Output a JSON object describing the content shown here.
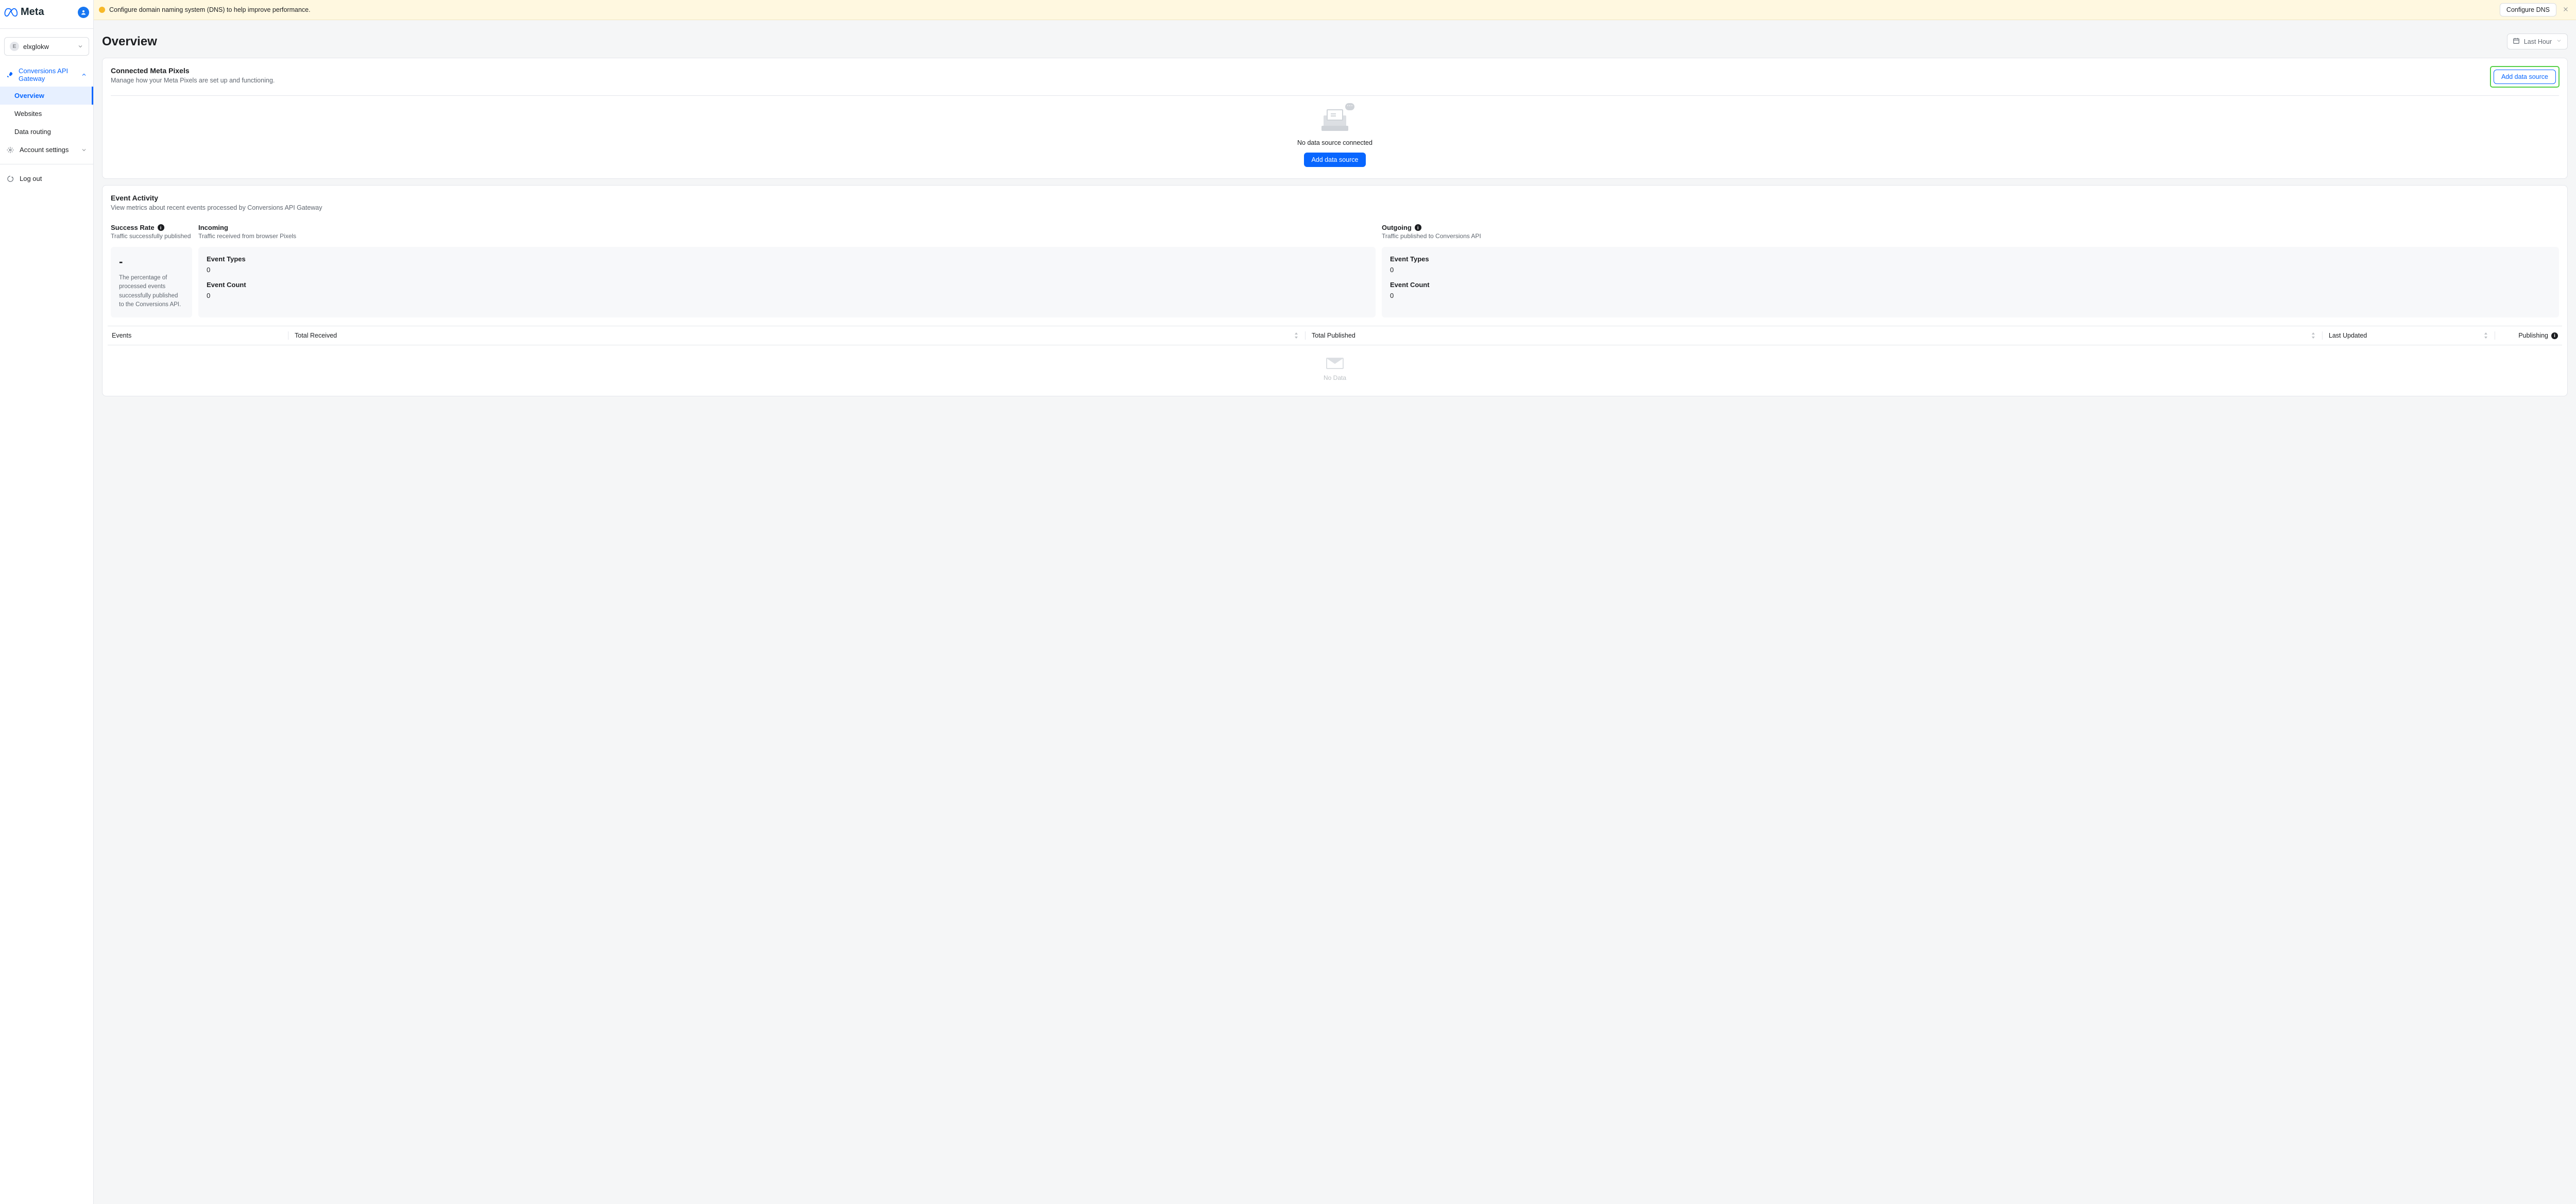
{
  "brand": {
    "name": "Meta"
  },
  "account": {
    "name": "elxglokw",
    "initial": "E"
  },
  "sidebar": {
    "parent": "Conversions API Gateway",
    "children": [
      "Overview",
      "Websites",
      "Data routing"
    ],
    "active_index": 0,
    "settings": "Account settings",
    "logout": "Log out"
  },
  "banner": {
    "text": "Configure domain naming system (DNS) to help improve performance.",
    "action": "Configure DNS"
  },
  "page": {
    "title": "Overview"
  },
  "range": {
    "label": "Last Hour"
  },
  "pixels": {
    "title": "Connected Meta Pixels",
    "sub": "Manage how your Meta Pixels are set up and functioning.",
    "add": "Add data source",
    "empty": "No data source connected",
    "empty_cta": "Add data source"
  },
  "activity": {
    "title": "Event Activity",
    "sub": "View metrics about recent events processed by Conversions API Gateway",
    "success": {
      "title": "Success Rate",
      "sub": "Traffic successfully published",
      "value": "-",
      "note": "The percentage of processed events successfully published to the Conversions API."
    },
    "incoming": {
      "title": "Incoming",
      "sub": "Traffic received from browser Pixels",
      "types_label": "Event Types",
      "types_value": "0",
      "count_label": "Event Count",
      "count_value": "0"
    },
    "outgoing": {
      "title": "Outgoing",
      "sub": "Traffic published to Conversions API",
      "types_label": "Event Types",
      "types_value": "0",
      "count_label": "Event Count",
      "count_value": "0"
    },
    "table": {
      "events": "Events",
      "received": "Total Received",
      "published": "Total Published",
      "updated": "Last Updated",
      "publishing": "Publishing",
      "no_data": "No Data"
    }
  }
}
